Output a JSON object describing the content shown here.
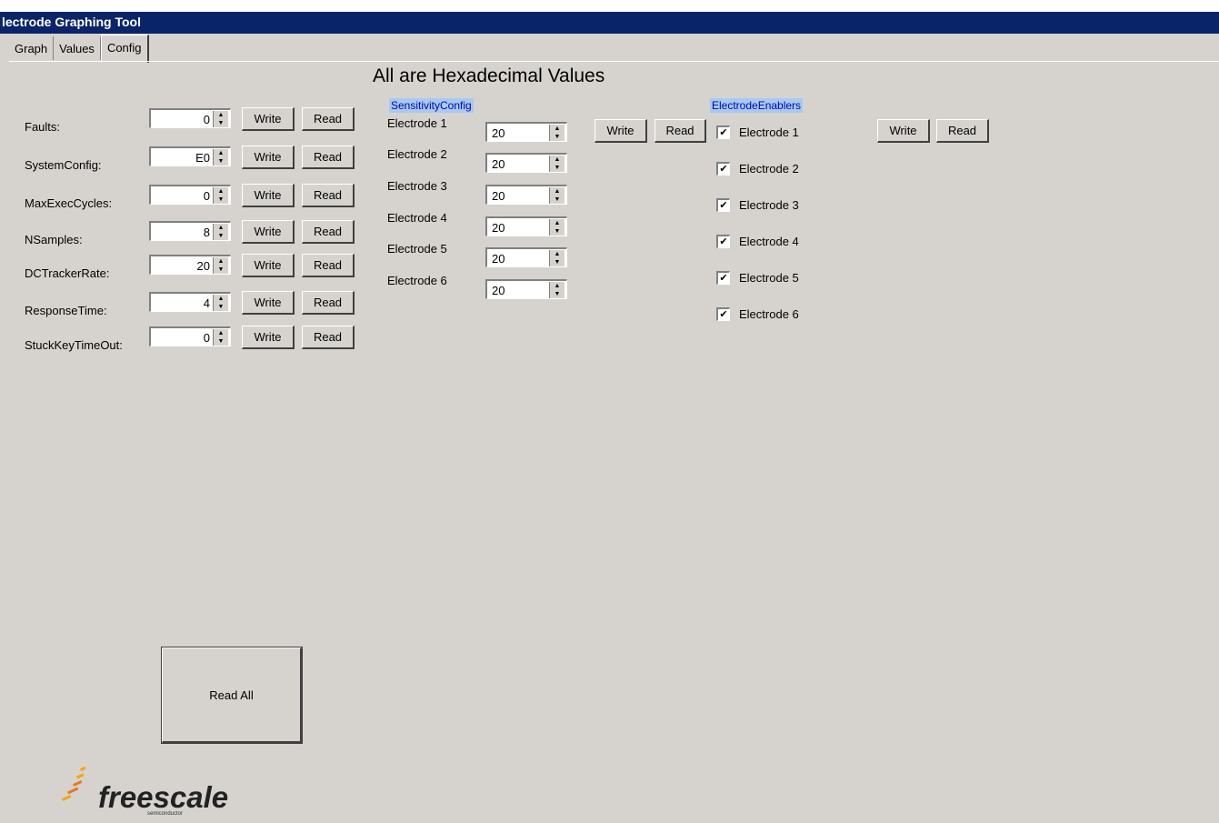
{
  "window": {
    "title": "lectrode Graphing Tool"
  },
  "tabs": [
    "Graph",
    "Values",
    "Config"
  ],
  "active_tab": "Config",
  "heading": "All are Hexadecimal Values",
  "params": [
    {
      "label": "Faults:",
      "value": "0"
    },
    {
      "label": "SystemConfig:",
      "value": "E0"
    },
    {
      "label": "MaxExecCycles:",
      "value": "0"
    },
    {
      "label": "NSamples:",
      "value": "8"
    },
    {
      "label": "DCTrackerRate:",
      "value": "20"
    },
    {
      "label": "ResponseTime:",
      "value": "4"
    },
    {
      "label": "StuckKeyTimeOut:",
      "value": "0"
    }
  ],
  "write_label": "Write",
  "read_label": "Read",
  "sensitivity": {
    "title": "SensitivityConfig",
    "items": [
      {
        "label": "Electrode 1",
        "value": "20"
      },
      {
        "label": "Electrode 2",
        "value": "20"
      },
      {
        "label": "Electrode 3",
        "value": "20"
      },
      {
        "label": "Electrode 4",
        "value": "20"
      },
      {
        "label": "Electrode 5",
        "value": "20"
      },
      {
        "label": "Electrode 6",
        "value": "20"
      }
    ]
  },
  "enablers": {
    "title": "ElectrodeEnablers",
    "items": [
      {
        "label": "Electrode 1",
        "checked": true
      },
      {
        "label": "Electrode 2",
        "checked": true
      },
      {
        "label": "Electrode 3",
        "checked": true
      },
      {
        "label": "Electrode 4",
        "checked": true
      },
      {
        "label": "Electrode 5",
        "checked": true
      },
      {
        "label": "Electrode 6",
        "checked": true
      }
    ]
  },
  "read_all_label": "Read All",
  "logo": {
    "text": "freescale",
    "subtext": "semiconductor",
    "colors": [
      "#f7a600",
      "#e87722"
    ]
  }
}
